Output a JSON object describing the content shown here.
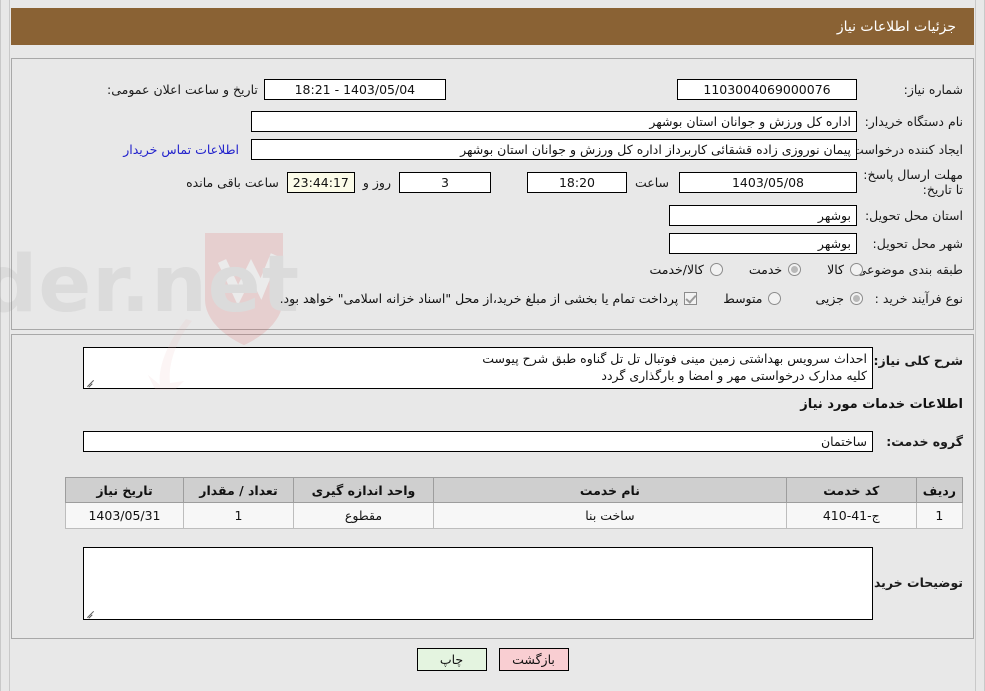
{
  "header": {
    "title": "جزئیات اطلاعات نیاز"
  },
  "form": {
    "need_number_label": "شماره نیاز:",
    "need_number_value": "1103004069000076",
    "announce_label": "تاریخ و ساعت اعلان عمومی:",
    "announce_value": "1403/05/04 - 18:21",
    "buyer_org_label": "نام دستگاه خریدار:",
    "buyer_org_value": "اداره کل ورزش و جوانان استان بوشهر",
    "creator_label": "ایجاد کننده درخواست:",
    "creator_value": "پیمان نوروزی زاده قشقائی کاربرداز اداره کل ورزش و جوانان استان بوشهر",
    "contact_link": "اطلاعات تماس خریدار",
    "deadline_label": "مهلت ارسال پاسخ: تا تاریخ:",
    "deadline_date": "1403/05/08",
    "hour_label": "ساعت",
    "hour_value": "18:20",
    "days_value": "3",
    "days_label": "روز و",
    "remaining_value": "23:44:17",
    "remaining_label": "ساعت باقی مانده",
    "province_label": "استان محل تحویل:",
    "province_value": "بوشهر",
    "city_label": "شهر محل تحویل:",
    "city_value": "بوشهر",
    "category_label": "طبقه بندی موضوعی:",
    "category_options": [
      {
        "label": "کالا",
        "selected": false
      },
      {
        "label": "خدمت",
        "selected": true
      },
      {
        "label": "کالا/خدمت",
        "selected": false
      }
    ],
    "process_label": "نوع فرآیند خرید :",
    "process_options": [
      {
        "label": "جزیی",
        "selected": true
      },
      {
        "label": "متوسط",
        "selected": false
      }
    ],
    "treasury_checked": true,
    "treasury_note": "پرداخت تمام یا بخشی از مبلغ خرید،از محل \"اسناد خزانه اسلامی\" خواهد بود."
  },
  "details": {
    "summary_label": "شرح کلی نیاز:",
    "summary_value": "احداث سرویس بهداشتی زمین مینی فوتبال تل تل گناوه طبق شرح پیوست\nکلیه مدارک درخواستی مهر و امضا و بارگذاری گردد",
    "services_heading": "اطلاعات خدمات مورد نیاز",
    "service_group_label": "گروه خدمت:",
    "service_group_value": "ساختمان",
    "table": {
      "columns": [
        "ردیف",
        "کد خدمت",
        "نام خدمت",
        "واحد اندازه گیری",
        "تعداد / مقدار",
        "تاریخ نیاز"
      ],
      "rows": [
        {
          "row": "1",
          "code": "ج-41-410",
          "name": "ساخت بنا",
          "unit": "مقطوع",
          "qty": "1",
          "date": "1403/05/31"
        }
      ]
    },
    "buyer_notes_label": "توضیحات خریدار:",
    "buyer_notes_value": ""
  },
  "footer": {
    "print_label": "چاپ",
    "back_label": "بازگشت"
  },
  "watermark": {
    "text": "AriaTender.net"
  },
  "colors": {
    "header_bg": "#8a6234",
    "link": "#2222cc",
    "back_btn": "#f9ced2",
    "print_btn": "#e4f4e0",
    "page_bg": "#e8e8e8"
  }
}
